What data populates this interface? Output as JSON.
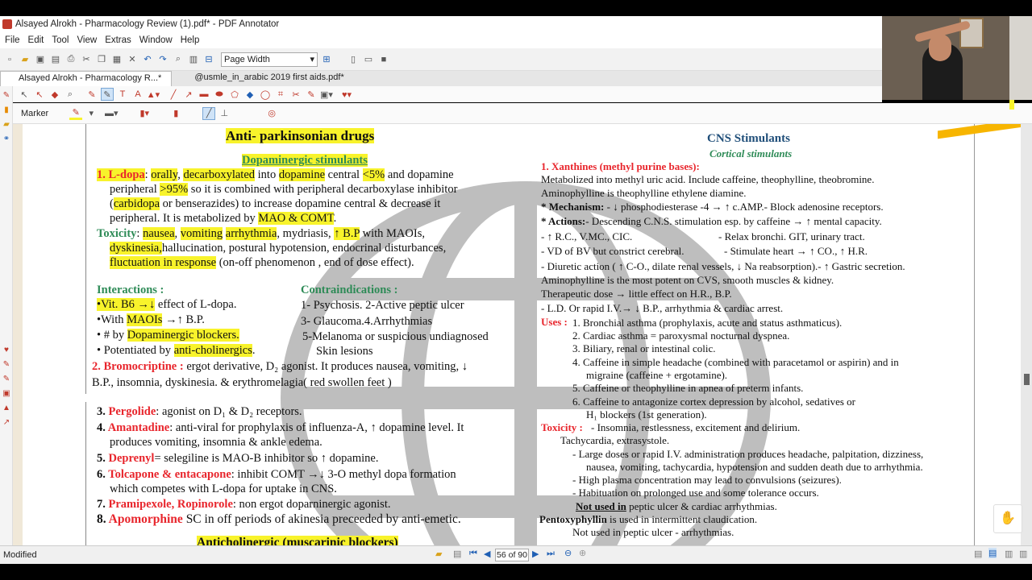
{
  "window": {
    "title": "Alsayed Alrokh - Pharmacology Review (1).pdf* - PDF Annotator"
  },
  "menu": [
    "File",
    "Edit",
    "Tool",
    "View",
    "Extras",
    "Window",
    "Help"
  ],
  "toolbar": {
    "zoom": "Page Width"
  },
  "tabs": [
    {
      "label": "Alsayed Alrokh - Pharmacology R...*"
    },
    {
      "label": "@usmle_in_arabic 2019 first aids.pdf*"
    }
  ],
  "tool_label": "Marker",
  "status": {
    "left": "Modified",
    "page": "56 of 90"
  },
  "colors": {
    "highlight": "#f8f32b",
    "heading_red": "#e8252c",
    "heading_green": "#2e8b57",
    "heading_blue": "#1f4e79"
  },
  "doc": {
    "left": {
      "title": "Anti- parkinsonian drugs",
      "subtitle": "Dopaminergic stimulants",
      "l1": [
        "1. L-dopa",
        ": ",
        "orally",
        ", ",
        "decarboxylated",
        " into ",
        "dopamine",
        " central ",
        "<5%",
        " and dopamine"
      ],
      "l2": [
        "peripheral ",
        ">95%",
        " so it is combined with peripheral decarboxylase inhibitor"
      ],
      "l3": [
        "(",
        "carbidopa",
        " or benserazides) to increase dopamine central & decrease it"
      ],
      "l4": [
        "peripheral. It is metabolized by ",
        "MAO & COMT",
        "."
      ],
      "l5": [
        "Toxicity",
        ": ",
        "nausea",
        ", ",
        "vomiting",
        " ",
        "arrhythmia",
        ", mydriasis, ",
        "↑ B.P",
        " with MAOIs,"
      ],
      "l6": [
        "dyskinesia,",
        "hallucination,   postural   hypotension,   endocrinal   disturbances,"
      ],
      "l7": [
        "fluctuation in response",
        " (on-off phenomenon , end of dose effect)."
      ],
      "interactions_h": "Interactions",
      "int1": [
        "•Vit. B6 →↓",
        " effect of L-dopa."
      ],
      "int2": [
        "•With ",
        "MAOIs",
        " →↑ B.P."
      ],
      "int3": [
        "• # by ",
        "Dopaminergic blockers."
      ],
      "int4": [
        "• Potentiated by ",
        "anti-cholinergics",
        "."
      ],
      "contra_h": "Contraindications",
      "c1": "1- Psychosis. 2-Active peptic ulcer",
      "c2": "3- Glaucoma.4.Arrhythmias",
      "c3": "5-Melanoma or suspicious undiagnosed",
      "c4": "Skin lesions",
      "b2": [
        "2. Bromocriptine :",
        " ergot derivative, D₂ agonist. It produces nausea, vomiting, ↓"
      ],
      "b2b": "B.P., insomnia, dyskinesia. & erythromelagia( red swollen feet )",
      "p3": [
        "3. ",
        "Pergolide",
        ": agonist on D₁ & D₂ receptors."
      ],
      "p4": [
        "4. ",
        "Amantadine",
        ": anti-viral for prophylaxis of influenza-A, ↑ dopamine level. It"
      ],
      "p4b": "produces vomiting, insomnia & ankle edema.",
      "p5": [
        "5. ",
        "Deprenyl",
        "= selegiline is MAO-B inhibitor so ↑ dopamine."
      ],
      "p6": [
        "6. ",
        "Tolcapone & entacapone",
        ": inhibit COMT →↓ 3-O methyl dopa formation"
      ],
      "p6b": "which competes with L-dopa for uptake in CNS.",
      "p7": [
        "7. ",
        "Pramipexole, Ropinorole",
        ": non ergot doparninergic agonist."
      ],
      "p8": [
        "8. ",
        "Apomorphine",
        " SC in off periods of akinesia preceeded by anti-emetic."
      ],
      "cut": "Anticholinergic (muscarinic blockers)"
    },
    "right": {
      "title": "CNS Stimulants",
      "subtitle": "Cortical stimulants",
      "h1": "1. Xanthines (methyl purine bases):",
      "r1": "Metabolized into methyl uric acid. Include caffeine, theophylline, theobromine.",
      "r2": "Aminophylline is theophylline ethylene diamine.",
      "r3": [
        "* Mechanism:",
        " - ↓ phosphodiesterase -4 → ↑ c.AMP.- Block adenosine receptors."
      ],
      "r4": [
        "* Actions:",
        "- Descending C.N.S. stimulation esp. by caffeine → ↑ mental capacity."
      ],
      "r5a": "- ↑ R.C., V.MC., CIC.",
      "r5b": "- Relax bronchi. GIT, urinary tract.",
      "r6a": "- VD of BV but constrict cerebral.",
      "r6b": "- Stimulate heart → ↑ CO., ↑ H.R.",
      "r7": "- Diuretic action ( ↑ C-O., dilate renal vessels, ↓ Na reabsorption).- ↑ Gastric secretion.",
      "r8": "Aminophylline is the most potent on CVS, smooth muscles & kidney.",
      "r9": "Therapeutic dose → little effect on H.R., B.P.",
      "r10": "- L.D. Or rapid I.V.→ ↓ B.P., arrhythmia & cardiac arrest.",
      "uses_h": "Uses :",
      "u1": "1. Bronchial asthma (prophylaxis, acute and status asthmaticus).",
      "u2": "2. Cardiac asthma = paroxysmal nocturnal dyspnea.",
      "u3": "3. Biliary, renal or intestinal colic.",
      "u4": "4. Caffeine in simple headache (combined with paracetamol  or aspirin) and in",
      "u4b": "migraine (caffeine + ergotamine).",
      "u5": "5. Caffeine or theophylline in apnea of preterm infants.",
      "u6": "6. Caffeine to antagonize cortex depression by alcohol, sedatives or",
      "u6b": "H₁ blockers (1st generation).",
      "tox_h": "Toxicity :",
      "t1": "- Insomnia, restlessness, excitement and delirium.",
      "t2": "Tachycardia, extrasystole.",
      "t3": "- Large doses or rapid I.V. administration produces headache, palpitation, dizziness,",
      "t3b": "nausea, vomiting, tachycardia, hypotension and sudden death due to arrhythmia.",
      "t4": "- High plasma concentration may lead to convulsions (seizures).",
      "t5": "- Habituation on prolonged use and some tolerance occurs.",
      "n1": [
        "Not used in",
        " peptic ulcer & cardiac arrhythmias."
      ],
      "n2": [
        "Pentoxyphyllin",
        " is used in intermittent claudication."
      ],
      "n3": "Not used in peptic ulcer - arrhythmias."
    }
  }
}
